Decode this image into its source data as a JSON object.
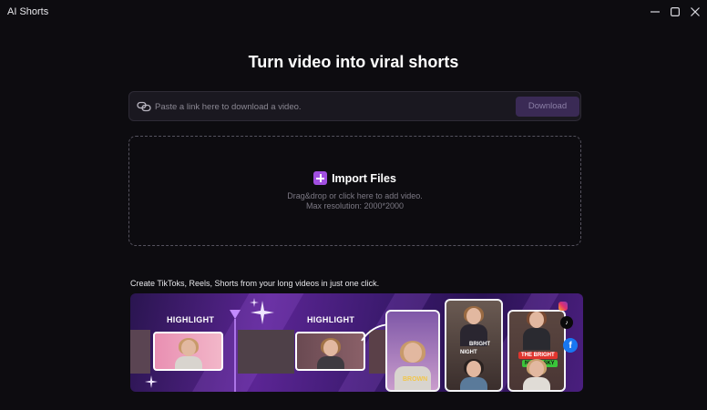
{
  "window": {
    "title": "AI Shorts"
  },
  "main": {
    "heading": "Turn video into viral shorts",
    "link_input": {
      "value": "",
      "placeholder": "Paste a link here to download a video."
    },
    "download_label": "Download",
    "import": {
      "label": "Import Files",
      "hint": "Drag&drop or click here to add video.",
      "max_resolution": "Max resolution: 2000*2000"
    },
    "promo": {
      "caption": "Create TikToks, Reels, Shorts from your long videos in just one click.",
      "highlight_label_1": "HIGHLIGHT",
      "highlight_label_2": "HIGHLIGHT",
      "caption_brown": "BROWN",
      "caption_bright": "BRIGHT",
      "caption_night": "NIGHT",
      "caption_the_bright": "THE BRIGHT",
      "caption_night_sky": "NIGHT SKY"
    }
  },
  "colors": {
    "background": "#0d0c10",
    "accent": "#a14fe0",
    "download_bg": "#3a2a55"
  }
}
